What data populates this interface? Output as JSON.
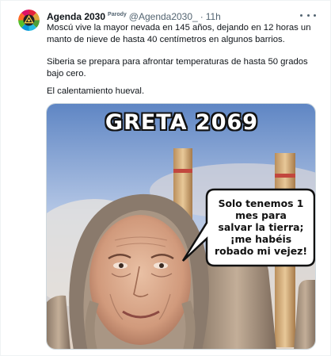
{
  "tweet": {
    "author_name": "Agenda 2030",
    "parody_label": "Parody",
    "handle": "@Agenda2030_",
    "separator": "·",
    "time": "11h",
    "paragraphs": [
      "Moscú vive la mayor nevada en 145 años, dejando en 12 horas un manto de nieve de hasta 40 centímetros en algunos barrios.",
      "Siberia se prepara para afrontar temperaturas de hasta 50 grados bajo cero.",
      "El calentamiento hueval."
    ]
  },
  "meme": {
    "caption": "GRETA 2069",
    "speech_lines": [
      "Solo tenemos 1",
      "mes para",
      "salvar la tierra;",
      "¡me habéis",
      "robado mi vejez!"
    ]
  },
  "icons": {
    "avatar": "agenda-2030-logo",
    "more": "more-options-icon"
  },
  "colors": {
    "secondary_text": "#536471",
    "border": "#cfd9de"
  }
}
